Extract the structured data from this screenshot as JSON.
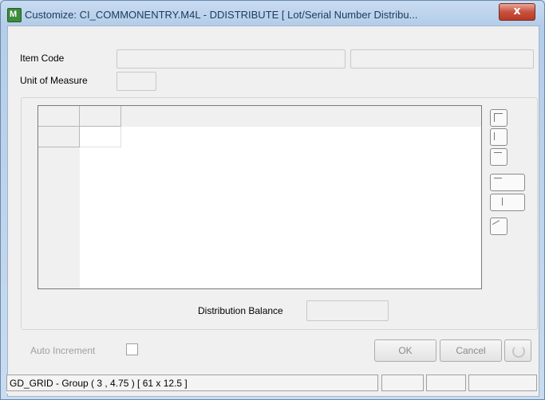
{
  "window": {
    "title": "Customize: CI_COMMONENTRY.M4L - DDISTRIBUTE  [ Lot/Serial Number Distribu...",
    "close_label": "x"
  },
  "form": {
    "item_code_label": "Item Code",
    "uom_label": "Unit of Measure",
    "distribution_balance_label": "Distribution Balance",
    "auto_increment_label": "Auto Increment"
  },
  "buttons": {
    "ok": "OK",
    "cancel": "Cancel"
  },
  "toolbar_icons": [
    "resize-grip-icon",
    "column-icon",
    "row-icon",
    "align-icon",
    "resize-icon",
    "properties-icon"
  ],
  "status_bar": {
    "text": "GD_GRID - Group  ( 3 , 4.75 )  [ 61 x 12.5 ]"
  }
}
